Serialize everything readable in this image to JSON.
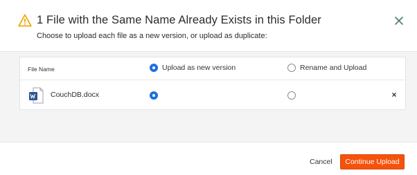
{
  "header": {
    "title": "1 File with the Same Name Already Exists in this Folder",
    "subtitle": "Choose to upload each file as a new version, or upload as duplicate:",
    "icon": "warning-triangle-icon",
    "close_icon": "close-icon"
  },
  "table": {
    "column_file_name": "File Name",
    "option_new_version": "Upload as new version",
    "option_rename": "Rename and Upload",
    "header_selected": "new_version",
    "rows": [
      {
        "file_name": "CouchDB.docx",
        "icon": "word-document-icon",
        "selected": "new_version",
        "remove_label": "×"
      }
    ]
  },
  "footer": {
    "cancel_label": "Cancel",
    "continue_label": "Continue Upload"
  },
  "colors": {
    "accent_orange": "#f5520c",
    "radio_selected": "#1f6fe0",
    "warning_yellow": "#f0a800",
    "word_blue": "#2b5797"
  }
}
